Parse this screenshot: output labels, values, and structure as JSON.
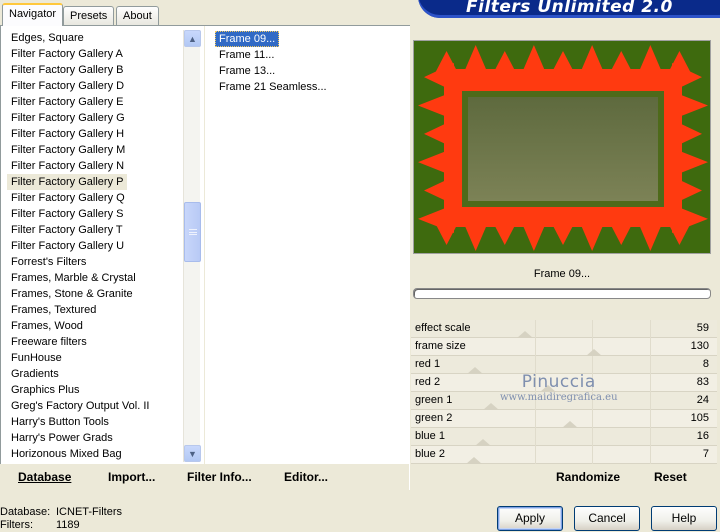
{
  "header": {
    "title": "Filters Unlimited 2.0"
  },
  "tabs": [
    {
      "label": "Navigator",
      "active": true
    },
    {
      "label": "Presets",
      "active": false
    },
    {
      "label": "About",
      "active": false
    }
  ],
  "categories": [
    "Edges, Square",
    "Filter Factory Gallery A",
    "Filter Factory Gallery B",
    "Filter Factory Gallery D",
    "Filter Factory Gallery E",
    "Filter Factory Gallery G",
    "Filter Factory Gallery H",
    "Filter Factory Gallery M",
    "Filter Factory Gallery N",
    "Filter Factory Gallery P",
    "Filter Factory Gallery Q",
    "Filter Factory Gallery S",
    "Filter Factory Gallery T",
    "Filter Factory Gallery U",
    "Forrest's Filters",
    "Frames, Marble & Crystal",
    "Frames, Stone & Granite",
    "Frames, Textured",
    "Frames, Wood",
    "Freeware filters",
    "FunHouse",
    "Gradients",
    "Graphics Plus",
    "Greg's Factory Output Vol. II",
    "Harry's Button Tools",
    "Harry's Power Grads",
    "Horizonous Mixed Bag"
  ],
  "selected_category_index": 9,
  "filters": [
    "Frame 09...",
    "Frame 11...",
    "Frame 13...",
    "Frame 21 Seamless..."
  ],
  "selected_filter_index": 0,
  "actions": {
    "database": "Database",
    "import": "Import...",
    "filter_info": "Filter Info...",
    "editor": "Editor..."
  },
  "preview": {
    "filter_name": "Frame 09...",
    "colors": {
      "outer": "#3E6A0E",
      "flame": "#FF3A10",
      "inner_top": "#5E6A3E",
      "inner_bottom": "#7C8256",
      "inner_border": "#4E6A1A"
    }
  },
  "parameters": [
    {
      "name": "effect scale",
      "value": 59
    },
    {
      "name": "frame size",
      "value": 130
    },
    {
      "name": "red 1",
      "value": 8
    },
    {
      "name": "red 2",
      "value": 83
    },
    {
      "name": "green 1",
      "value": 24
    },
    {
      "name": "green 2",
      "value": 105
    },
    {
      "name": "blue 1",
      "value": 16
    },
    {
      "name": "blue 2",
      "value": 7
    }
  ],
  "watermark": {
    "name": "Pinuccia",
    "site": "www.maidiregrafica.eu"
  },
  "buttons": {
    "randomize": "Randomize",
    "reset": "Reset",
    "apply": "Apply",
    "cancel": "Cancel",
    "help": "Help"
  },
  "status": {
    "database_label": "Database:",
    "database_value": "ICNET-Filters",
    "filters_label": "Filters:",
    "filters_value": "1189"
  }
}
